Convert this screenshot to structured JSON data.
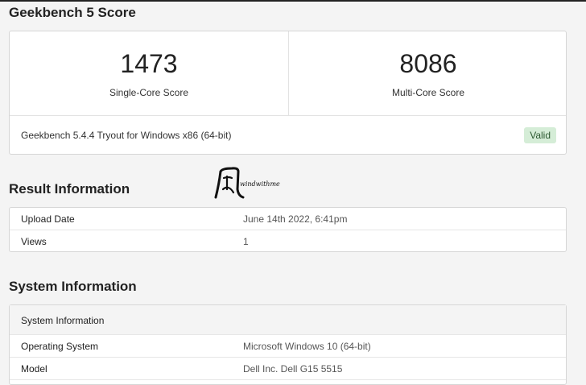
{
  "score_section": {
    "title": "Geekbench 5 Score",
    "single_core": {
      "value": "1473",
      "label": "Single-Core Score"
    },
    "multi_core": {
      "value": "8086",
      "label": "Multi-Core Score"
    },
    "version": "Geekbench 5.4.4 Tryout for Windows x86 (64-bit)",
    "status_badge": "Valid",
    "badge_color": "#d5edd7"
  },
  "result_section": {
    "title": "Result Information",
    "rows": [
      {
        "key": "Upload Date",
        "value": "June 14th 2022, 6:41pm"
      },
      {
        "key": "Views",
        "value": "1"
      }
    ]
  },
  "system_section": {
    "title": "System Information",
    "table_header": "System Information",
    "rows": [
      {
        "key": "Operating System",
        "value": "Microsoft Windows 10 (64-bit)"
      },
      {
        "key": "Model",
        "value": "Dell Inc. Dell G15 5515"
      }
    ]
  },
  "watermark": {
    "text": "windwithme"
  }
}
